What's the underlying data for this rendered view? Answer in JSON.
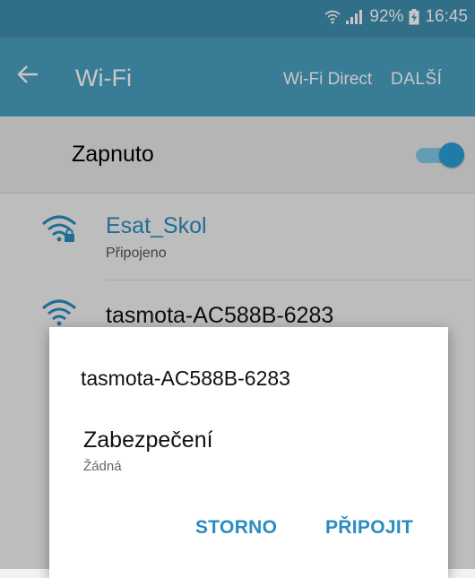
{
  "status_bar": {
    "battery": "92%",
    "time": "16:45"
  },
  "app_bar": {
    "title": "Wi-Fi",
    "wifi_direct": "Wi-Fi Direct",
    "more": "DALŠÍ"
  },
  "wifi_toggle": {
    "label": "Zapnuto",
    "enabled": true
  },
  "networks": [
    {
      "name": "Esat_Skol",
      "status": "Připojeno",
      "secured": true,
      "connected": true
    },
    {
      "name": "tasmota-AC588B-6283",
      "status": "",
      "secured": false,
      "connected": false
    }
  ],
  "dialog": {
    "title": "tasmota-AC588B-6283",
    "security_label": "Zabezpečení",
    "security_value": "Žádná",
    "cancel": "STORNO",
    "connect": "PŘIPOJIT"
  },
  "colors": {
    "accent": "#2a8cc0",
    "app_bar": "#4a9fc0",
    "status_bar": "#3e8fae"
  },
  "icons": [
    "wifi-icon",
    "signal-icon",
    "battery-charging-icon",
    "back-arrow-icon",
    "wifi-lock-icon"
  ]
}
